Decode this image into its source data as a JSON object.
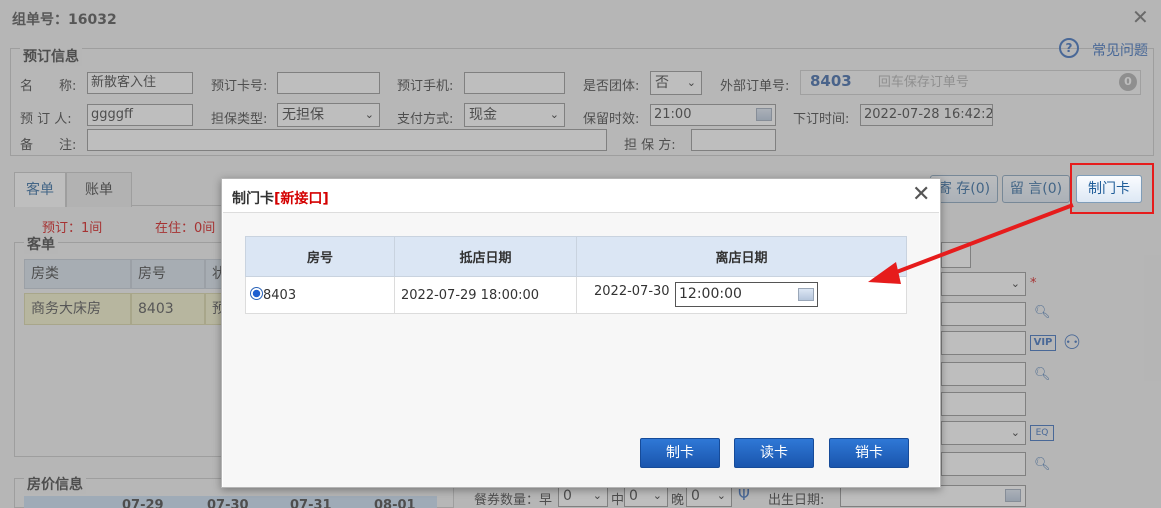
{
  "window": {
    "title": "组单号：16032",
    "close": "✕"
  },
  "booking": {
    "legend": "预订信息",
    "help_label": "常见问题",
    "name_label": "名　　称:",
    "name_value": "新散客入住",
    "card_label": "预订卡号:",
    "card_value": "",
    "phone_label": "预订手机:",
    "phone_value": "",
    "group_label": "是否团体:",
    "group_value": "否",
    "external_label": "外部订单号:",
    "external_value": "8403",
    "external_placeholder": "回车保存订单号",
    "booker_label": "预 订 人:",
    "booker_value": "ggggff",
    "guarantee_type_label": "担保类型:",
    "guarantee_type_value": "无担保",
    "payment_label": "支付方式:",
    "payment_value": "现金",
    "hold_label": "保留时效:",
    "hold_value": "21:00",
    "order_time_label": "下订时间:",
    "order_time_value": "2022-07-28 16:42:2",
    "remark_label": "备　　注:",
    "remark_value": "",
    "guarantor_label": "担 保 方:",
    "guarantor_value": ""
  },
  "tabs": [
    "客单",
    "账单"
  ],
  "status": {
    "reserved": "预订：1间",
    "staying": "在住：0间"
  },
  "guest_section": {
    "legend": "客单",
    "headers": [
      "房类",
      "房号",
      "状"
    ],
    "rows": [
      [
        "商务大床房",
        "8403",
        "预"
      ]
    ]
  },
  "right_buttons": {
    "deposit": "寄 存(0)",
    "message": "留 言(0)",
    "make_card": "制门卡"
  },
  "price_section": {
    "legend": "房价信息",
    "dates": [
      "07-29",
      "07-30",
      "07-31",
      "08-01"
    ]
  },
  "bottom_row": {
    "coupon_label": "餐券数量：早",
    "coupon_b": "0",
    "mid_label": "中",
    "coupon_l": "0",
    "late_label": "晚",
    "coupon_d": "0",
    "birth_label": "出生日期:"
  },
  "dialog": {
    "title_prefix": "制门卡",
    "title_tag": "[新接口]",
    "close": "✕",
    "headers": [
      "房号",
      "抵店日期",
      "离店日期"
    ],
    "rows": [
      {
        "room": "8403",
        "arrive": "2022-07-29 18:00:00",
        "depart_date": "2022-07-30",
        "depart_time": "12:00:00"
      }
    ],
    "buttons": {
      "make": "制卡",
      "read": "读卡",
      "cancel": "销卡"
    }
  },
  "annotation": {
    "color": "#e61c1c"
  }
}
